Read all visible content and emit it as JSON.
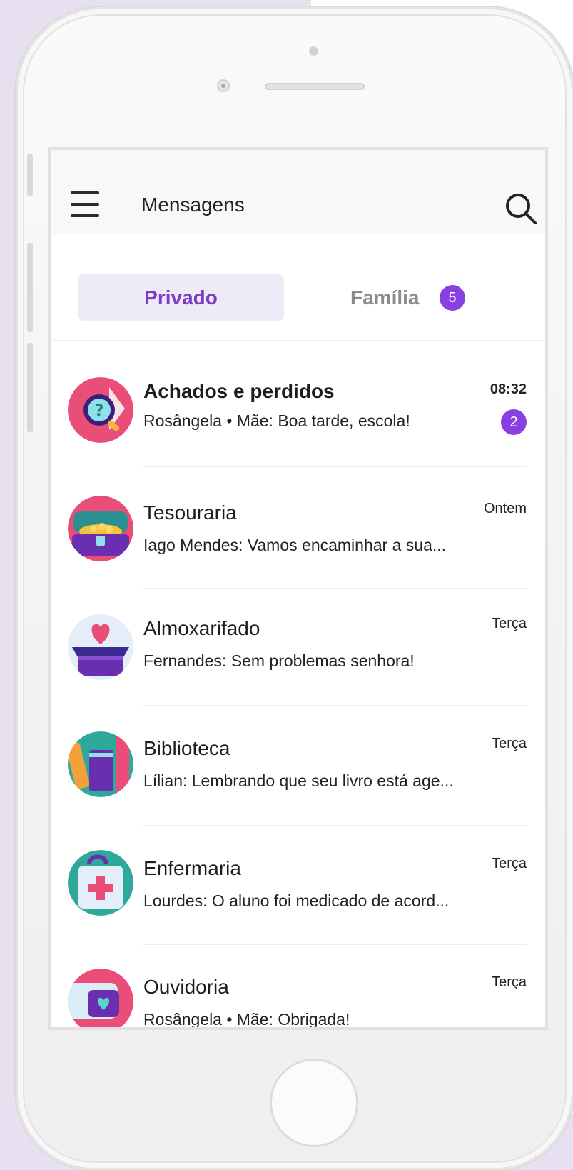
{
  "header": {
    "title": "Mensagens"
  },
  "tabs": {
    "private_label": "Privado",
    "family_label": "Família",
    "family_badge": "5"
  },
  "conversations": [
    {
      "title": "Achados e perdidos",
      "preview": "Rosângela  •  Mãe: Boa tarde, escola!",
      "time": "08:32",
      "unread": "2",
      "icon": "lost-and-found-icon"
    },
    {
      "title": "Tesouraria",
      "preview": "Iago Mendes: Vamos encaminhar a sua...",
      "time": "Ontem",
      "icon": "treasure-chest-icon"
    },
    {
      "title": "Almoxarifado",
      "preview": "Fernandes: Sem problemas senhora!",
      "time": "Terça",
      "icon": "heart-box-icon"
    },
    {
      "title": "Biblioteca",
      "preview": "Lílian: Lembrando que seu livro está age...",
      "time": "Terça",
      "icon": "books-icon"
    },
    {
      "title": "Enfermaria",
      "preview": "Lourdes: O aluno foi medicado de acord...",
      "time": "Terça",
      "icon": "first-aid-kit-icon"
    },
    {
      "title": "Ouvidoria",
      "preview": "Rosângela  •  Mãe: Obrigada!",
      "time": "Terça",
      "icon": "chat-bubbles-icon"
    }
  ],
  "colors": {
    "accent": "#8a3fe0",
    "tab_active_bg": "#efeaf8",
    "tab_active_text": "#7b3fc7",
    "background_lavender": "#e8dff0"
  }
}
